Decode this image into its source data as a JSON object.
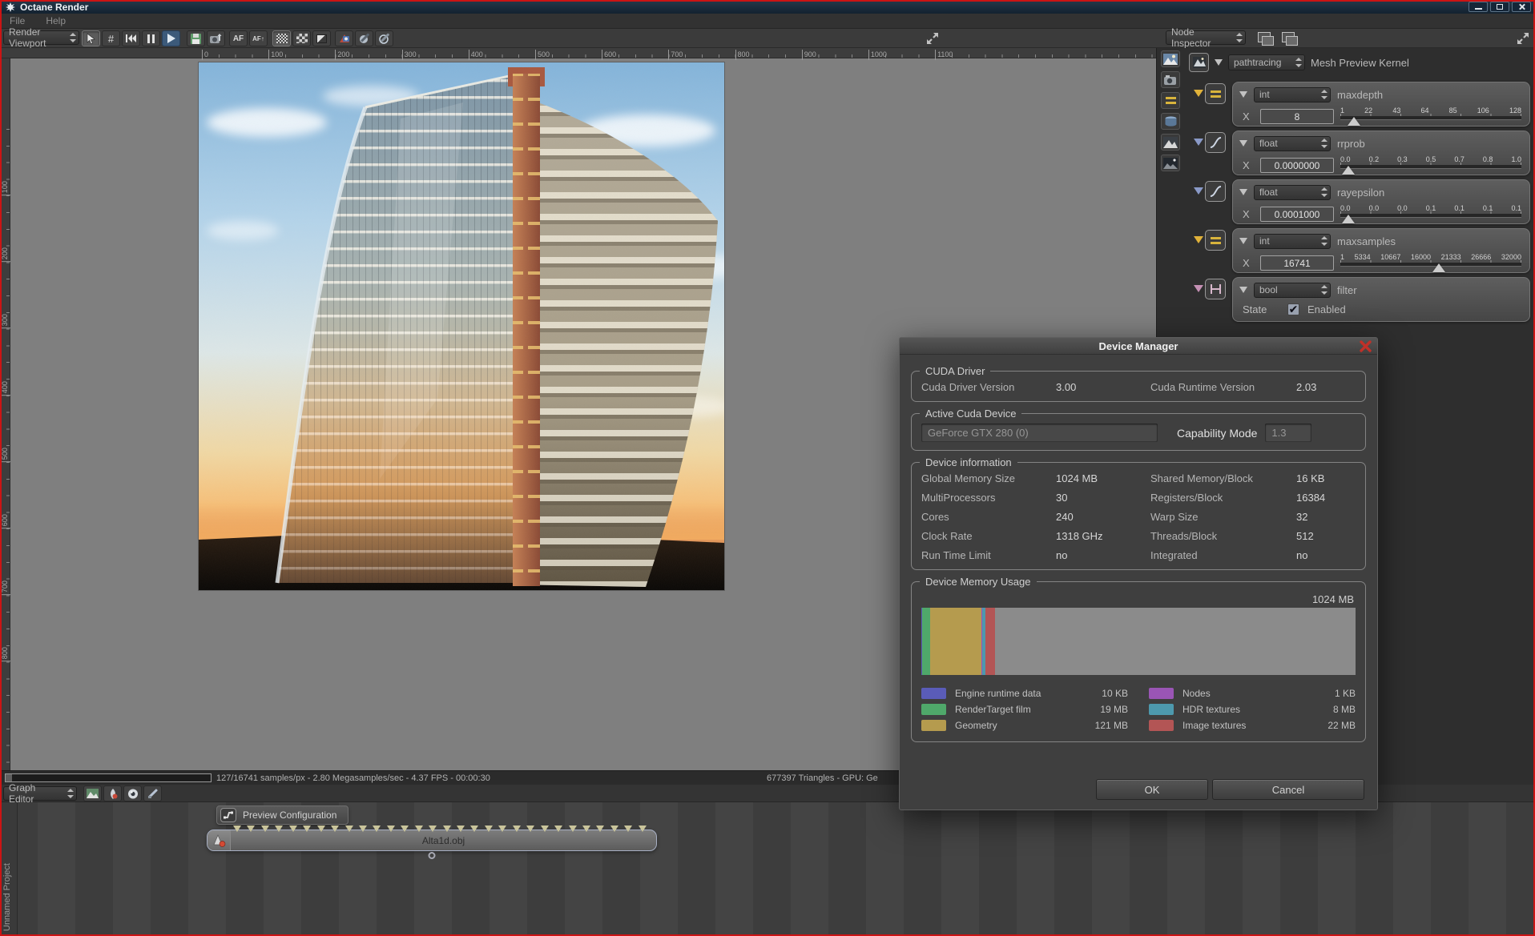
{
  "window": {
    "title": "Octane Render"
  },
  "menu": [
    "File",
    "Help"
  ],
  "viewport": {
    "selector": "Render Viewport",
    "ruler_h": [
      "0",
      "100",
      "200",
      "300",
      "400",
      "500",
      "600",
      "700",
      "800",
      "900",
      "1000",
      "1100"
    ],
    "ruler_v": [
      "100",
      "200",
      "300",
      "400",
      "500",
      "600",
      "700",
      "800"
    ],
    "status_left": "127/16741 samples/px - 2.80 Megasamples/sec - 4.37 FPS - 00:00:30",
    "status_right": "677397 Triangles - GPU: Ge"
  },
  "icon_names": [
    "octane-logo-icon",
    "minimize-icon",
    "maximize-icon",
    "close-icon",
    "cursor-tool-icon",
    "frame-tool-icon",
    "restart-render-icon",
    "pause-render-icon",
    "play-render-icon",
    "save-image-icon",
    "camera-icon",
    "autofocus-icon",
    "autofocus-pin-icon",
    "checker-fine-icon",
    "checker-coarse-icon",
    "contrast-icon",
    "pick-material-icon",
    "pen-icon",
    "pen-alt-icon",
    "expand-icon",
    "layer-icon",
    "image-icon",
    "night-image-icon",
    "bars-icon",
    "curve-icon",
    "bool-icon",
    "node-graph-icon",
    "eye-icon",
    "material-ball-icon",
    "link-icon",
    "cone-icon"
  ],
  "node_inspector": {
    "title": "Node Inspector",
    "root_type": "pathtracing",
    "root_label": "Mesh Preview Kernel",
    "params": [
      {
        "type": "int",
        "name": "maxdepth",
        "axis": "X",
        "value": "8",
        "ticks": [
          "1",
          "22",
          "43",
          "64",
          "85",
          "106",
          "128"
        ],
        "handle_left": "4%",
        "accent": "#e0b23a"
      },
      {
        "type": "float",
        "name": "rrprob",
        "axis": "X",
        "value": "0.0000000",
        "ticks": [
          "0.0",
          "0.2",
          "0.3",
          "0.5",
          "0.7",
          "0.8",
          "1.0"
        ],
        "handle_left": "1%",
        "accent": "#8a9ac8"
      },
      {
        "type": "float",
        "name": "rayepsilon",
        "axis": "X",
        "value": "0.0001000",
        "ticks": [
          "0.0",
          "0.0",
          "0.0",
          "0.1",
          "0.1",
          "0.1",
          "0.1"
        ],
        "handle_left": "1%",
        "accent": "#8a9ac8"
      },
      {
        "type": "int",
        "name": "maxsamples",
        "axis": "X",
        "value": "16741",
        "ticks": [
          "1",
          "5334",
          "10667",
          "16000",
          "21333",
          "26666",
          "32000"
        ],
        "handle_left": "51%",
        "accent": "#e0b23a"
      },
      {
        "type": "bool",
        "name": "filter",
        "state_label": "State",
        "check_label": "Enabled",
        "checked": "✔",
        "accent": "#c490b4"
      }
    ]
  },
  "device_manager": {
    "title": "Device Manager",
    "cuda_driver": {
      "legend": "CUDA Driver",
      "l1": "Cuda Driver Version",
      "v1": "3.00",
      "l2": "Cuda Runtime Version",
      "v2": "2.03"
    },
    "active_device": {
      "legend": "Active Cuda Device",
      "device": "GeForce GTX 280 (0)",
      "cap_label": "Capability Mode",
      "cap_value": "1.3"
    },
    "device_info": {
      "legend": "Device information",
      "rows": [
        {
          "l1": "Global Memory Size",
          "v1": "1024 MB",
          "l2": "Shared Memory/Block",
          "v2": "16 KB"
        },
        {
          "l1": "MultiProcessors",
          "v1": "30",
          "l2": "Registers/Block",
          "v2": "16384"
        },
        {
          "l1": "Cores",
          "v1": "240",
          "l2": "Warp Size",
          "v2": "32"
        },
        {
          "l1": "Clock Rate",
          "v1": "1318 GHz",
          "l2": "Threads/Block",
          "v2": "512"
        },
        {
          "l1": "Run Time Limit",
          "v1": "no",
          "l2": "Integrated",
          "v2": "no"
        }
      ]
    },
    "memory": {
      "legend": "Device Memory Usage",
      "total": "1024 MB",
      "segments": [
        {
          "name": "Engine runtime data",
          "width": "0.15%",
          "color": "#5a5cb8"
        },
        {
          "name": "RenderTarget film",
          "width": "1.9%",
          "color": "#4fa86a"
        },
        {
          "name": "Geometry",
          "width": "11.8%",
          "color": "#b59b4e"
        },
        {
          "name": "Nodes",
          "width": "0.15%",
          "color": "#9a55b5"
        },
        {
          "name": "HDR textures",
          "width": "0.8%",
          "color": "#4d99ad"
        },
        {
          "name": "Image textures",
          "width": "2.1%",
          "color": "#b35555"
        }
      ],
      "legend_left": [
        {
          "name": "Engine runtime data",
          "value": "10 KB",
          "color": "#5a5cb8"
        },
        {
          "name": "RenderTarget film",
          "value": "19 MB",
          "color": "#4fa86a"
        },
        {
          "name": "Geometry",
          "value": "121 MB",
          "color": "#b59b4e"
        }
      ],
      "legend_right": [
        {
          "name": "Nodes",
          "value": "1 KB",
          "color": "#9a55b5"
        },
        {
          "name": "HDR textures",
          "value": "8 MB",
          "color": "#4d99ad"
        },
        {
          "name": "Image textures",
          "value": "22 MB",
          "color": "#b35555"
        }
      ]
    },
    "ok": "OK",
    "cancel": "Cancel"
  },
  "graph_editor": {
    "title": "Graph Editor",
    "project": "Unnamed Project",
    "tab": "Preview Configuration",
    "node": "Alta1d.obj"
  }
}
